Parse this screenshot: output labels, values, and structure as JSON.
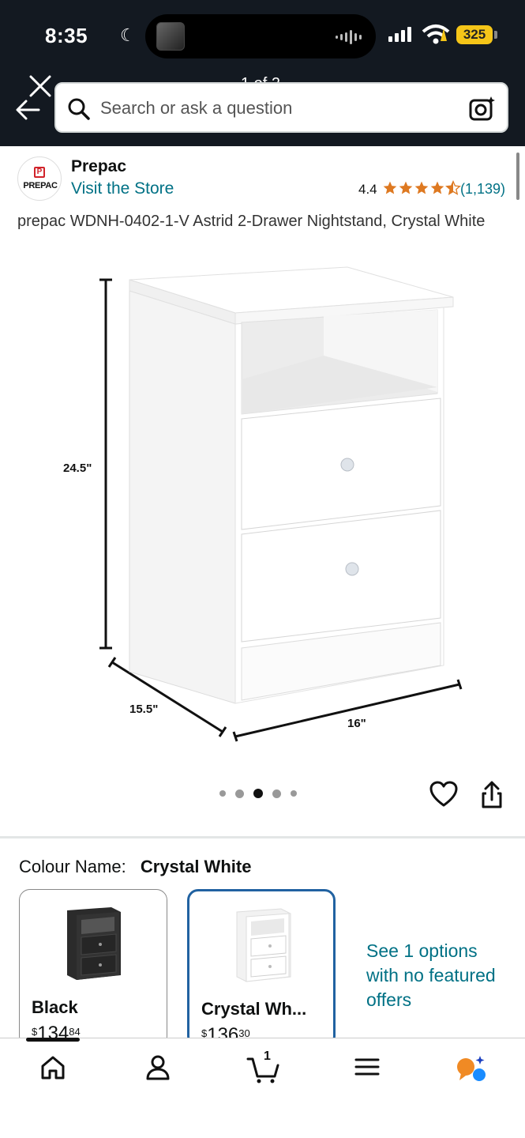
{
  "status_bar": {
    "time": "8:35",
    "battery": "325"
  },
  "header": {
    "pager": "1 of 2",
    "search_placeholder": "Search or ask a question"
  },
  "brand": {
    "logo_text": "PREPAC",
    "name": "Prepac",
    "visit_store": "Visit the Store",
    "rating": "4.4",
    "rating_count": "(1,139)"
  },
  "product": {
    "title": "prepac WDNH-0402-1-V Astrid 2-Drawer Nightstand, Crystal White",
    "dimensions": {
      "height": "24.5\"",
      "depth": "15.5\"",
      "width": "16\""
    },
    "image_count": 5,
    "active_image": 3
  },
  "colour": {
    "label": "Colour Name:",
    "selected": "Crystal White",
    "options": [
      {
        "name": "Black",
        "price_symbol": "$",
        "price_main": "134",
        "price_cents": "84"
      },
      {
        "name": "Crystal Wh...",
        "price_symbol": "$",
        "price_main": "136",
        "price_cents": "30"
      }
    ],
    "see_more": "See 1 options with no featured offers"
  },
  "bottom_nav": {
    "icons": [
      "home-icon",
      "account-icon",
      "cart-icon",
      "menu-icon",
      "rufus-icon"
    ],
    "cart_count": "1"
  },
  "colors": {
    "header_bg": "#131921",
    "link": "#007185",
    "star": "#de7921",
    "selected_border": "#2162a1"
  }
}
